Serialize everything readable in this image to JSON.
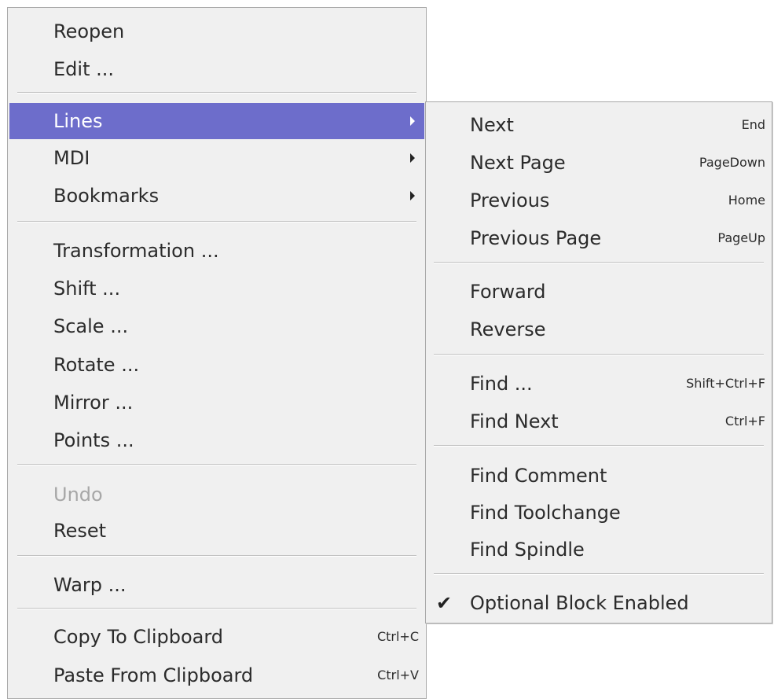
{
  "main_menu": {
    "reopen": "Reopen",
    "edit": "Edit ...",
    "lines": "Lines",
    "mdi": "MDI",
    "bookmarks": "Bookmarks",
    "transformation": "Transformation ...",
    "shift": "Shift ...",
    "scale": "Scale ...",
    "rotate": "Rotate ...",
    "mirror": "Mirror ...",
    "points": "Points ...",
    "undo": "Undo",
    "reset": "Reset",
    "warp": "Warp ...",
    "copy": "Copy To Clipboard",
    "copy_shortcut": "Ctrl+C",
    "paste": "Paste From Clipboard",
    "paste_shortcut": "Ctrl+V"
  },
  "sub_menu": {
    "next": "Next",
    "next_shortcut": "End",
    "next_page": "Next Page",
    "next_page_shortcut": "PageDown",
    "previous": "Previous",
    "previous_shortcut": "Home",
    "previous_page": "Previous Page",
    "previous_page_shortcut": "PageUp",
    "forward": "Forward",
    "reverse": "Reverse",
    "find": "Find ...",
    "find_shortcut": "Shift+Ctrl+F",
    "find_next": "Find Next",
    "find_next_shortcut": "Ctrl+F",
    "find_comment": "Find Comment",
    "find_toolchange": "Find Toolchange",
    "find_spindle": "Find Spindle",
    "optional_block": "Optional Block Enabled",
    "optional_block_checked": true
  },
  "colors": {
    "menu_background": "#f0f0f0",
    "highlight": "#6d6dcb",
    "disabled_text": "#a7a7a7"
  }
}
